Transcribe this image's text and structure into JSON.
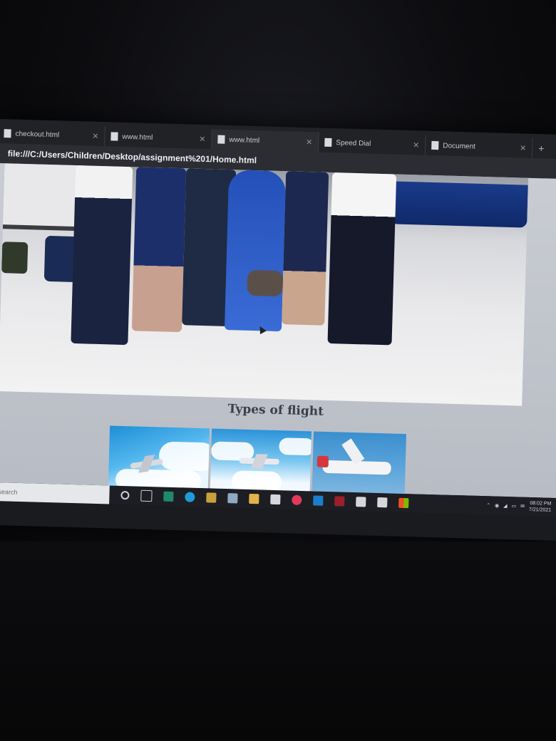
{
  "browser": {
    "tabs": [
      {
        "label": "checkout.html"
      },
      {
        "label": "www.html"
      },
      {
        "label": "www.html"
      },
      {
        "label": "Speed Dial"
      },
      {
        "label": "Document"
      }
    ],
    "new_tab_label": "+",
    "address": "file:///C:/Users/Children/Desktop/assignment%201/Home.html"
  },
  "page": {
    "section_title": "Types of flight"
  },
  "taskbar": {
    "search_placeholder": "to search",
    "clock_time": "08:02 PM",
    "clock_date": "7/21/2021"
  },
  "colors": {
    "accent_blue": "#2b93d9",
    "page_bg": "#c9ccd3",
    "taskbar_bg": "#1c1e24"
  }
}
